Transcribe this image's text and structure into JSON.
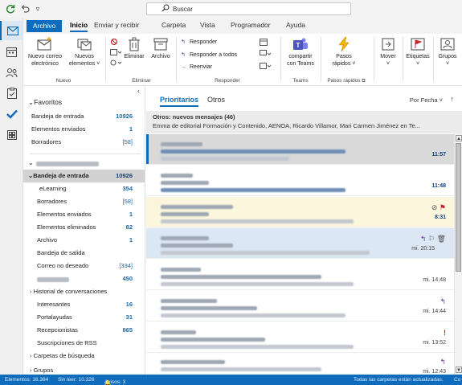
{
  "titlebar": {
    "search_placeholder": "Buscar"
  },
  "ribbon_tabs": [
    "Archivo",
    "Inicio",
    "Enviar y recibir",
    "Carpeta",
    "Vista",
    "Programador",
    "Ayuda"
  ],
  "ribbon": {
    "nuevo": {
      "new_mail": [
        "Nuevo correo",
        "electrónico"
      ],
      "new_items": [
        "Nuevos",
        "elementos"
      ],
      "group": "Nuevo"
    },
    "eliminar": {
      "delete": "Eliminar",
      "archive": "Archivo",
      "group": "Eliminar"
    },
    "responder": {
      "reply": "Responder",
      "reply_all": "Responder a todos",
      "forward": "Reenviar",
      "group": "Responder"
    },
    "teams": {
      "share": [
        "compartir",
        "con Teams"
      ],
      "group": "Teams"
    },
    "pasos": {
      "quick_steps": [
        "Pasos",
        "rápidos"
      ],
      "group": "Pasos rápidos"
    },
    "move": "Mover",
    "tags": "Etiquetas",
    "groups": "Grupos"
  },
  "folders": {
    "favorites_header": "Favoritos",
    "favorites": [
      {
        "label": "Bandeja de entrada",
        "count": "10926"
      },
      {
        "label": "Elementos enviados",
        "count": "1"
      },
      {
        "label": "Borradores",
        "count": "[58]"
      }
    ],
    "inbox_header": "Bandeja de entrada",
    "inbox_count": "10926",
    "account": [
      {
        "label": "eLearning",
        "count": "354"
      },
      {
        "label": "Borradores",
        "count": "[58]"
      },
      {
        "label": "Elementos enviados",
        "count": "1"
      },
      {
        "label": "Elementos eliminados",
        "count": "82"
      },
      {
        "label": "Archivo",
        "count": "1"
      },
      {
        "label": "Bandeja de salida",
        "count": ""
      },
      {
        "label": "Correo no deseado",
        "count": "[334]"
      },
      {
        "label": "",
        "count": "450"
      },
      {
        "label": "Historial de conversaciones",
        "count": ""
      },
      {
        "label": "Interesantes",
        "count": "16"
      },
      {
        "label": "Portalayudas",
        "count": "31"
      },
      {
        "label": "Recepcionistas",
        "count": "865"
      },
      {
        "label": "Suscripciones de RSS",
        "count": ""
      },
      {
        "label": "Carpetas de búsqueda",
        "count": ""
      },
      {
        "label": "Grupos",
        "count": ""
      }
    ]
  },
  "message_list": {
    "tab_focused": "Prioritarios",
    "tab_other": "Otros",
    "sort": "Por Fecha",
    "others_title": "Otros: nuevos mensajes (46)",
    "others_senders": "Emma de editorial Formación y Contenido, AENOA, Ricardo Villamor, Mari Carmen Jiménez en Te...",
    "messages": [
      {
        "time": "11:57"
      },
      {
        "time": "11:48"
      },
      {
        "time": "8:31"
      },
      {
        "time": "mi. 20:15"
      },
      {
        "time": "mi. 14:48"
      },
      {
        "time": "mi. 14:44"
      },
      {
        "time": "mi. 13:52"
      },
      {
        "time": "mi. 12:43"
      }
    ]
  },
  "statusbar": {
    "items": "Elementos: 16.384",
    "unread": "Sin leer: 10.326",
    "alerts": "Avisos: 3",
    "sync": "Todas las carpetas están actualizadas.",
    "connected": "Co"
  },
  "colors": {
    "accent": "#0f6cbd",
    "flag": "#c4262e",
    "highlight_yellow": "#fbf6dc",
    "highlight_blue": "#dbe7f3",
    "selected_gray": "#d8d8d8"
  }
}
